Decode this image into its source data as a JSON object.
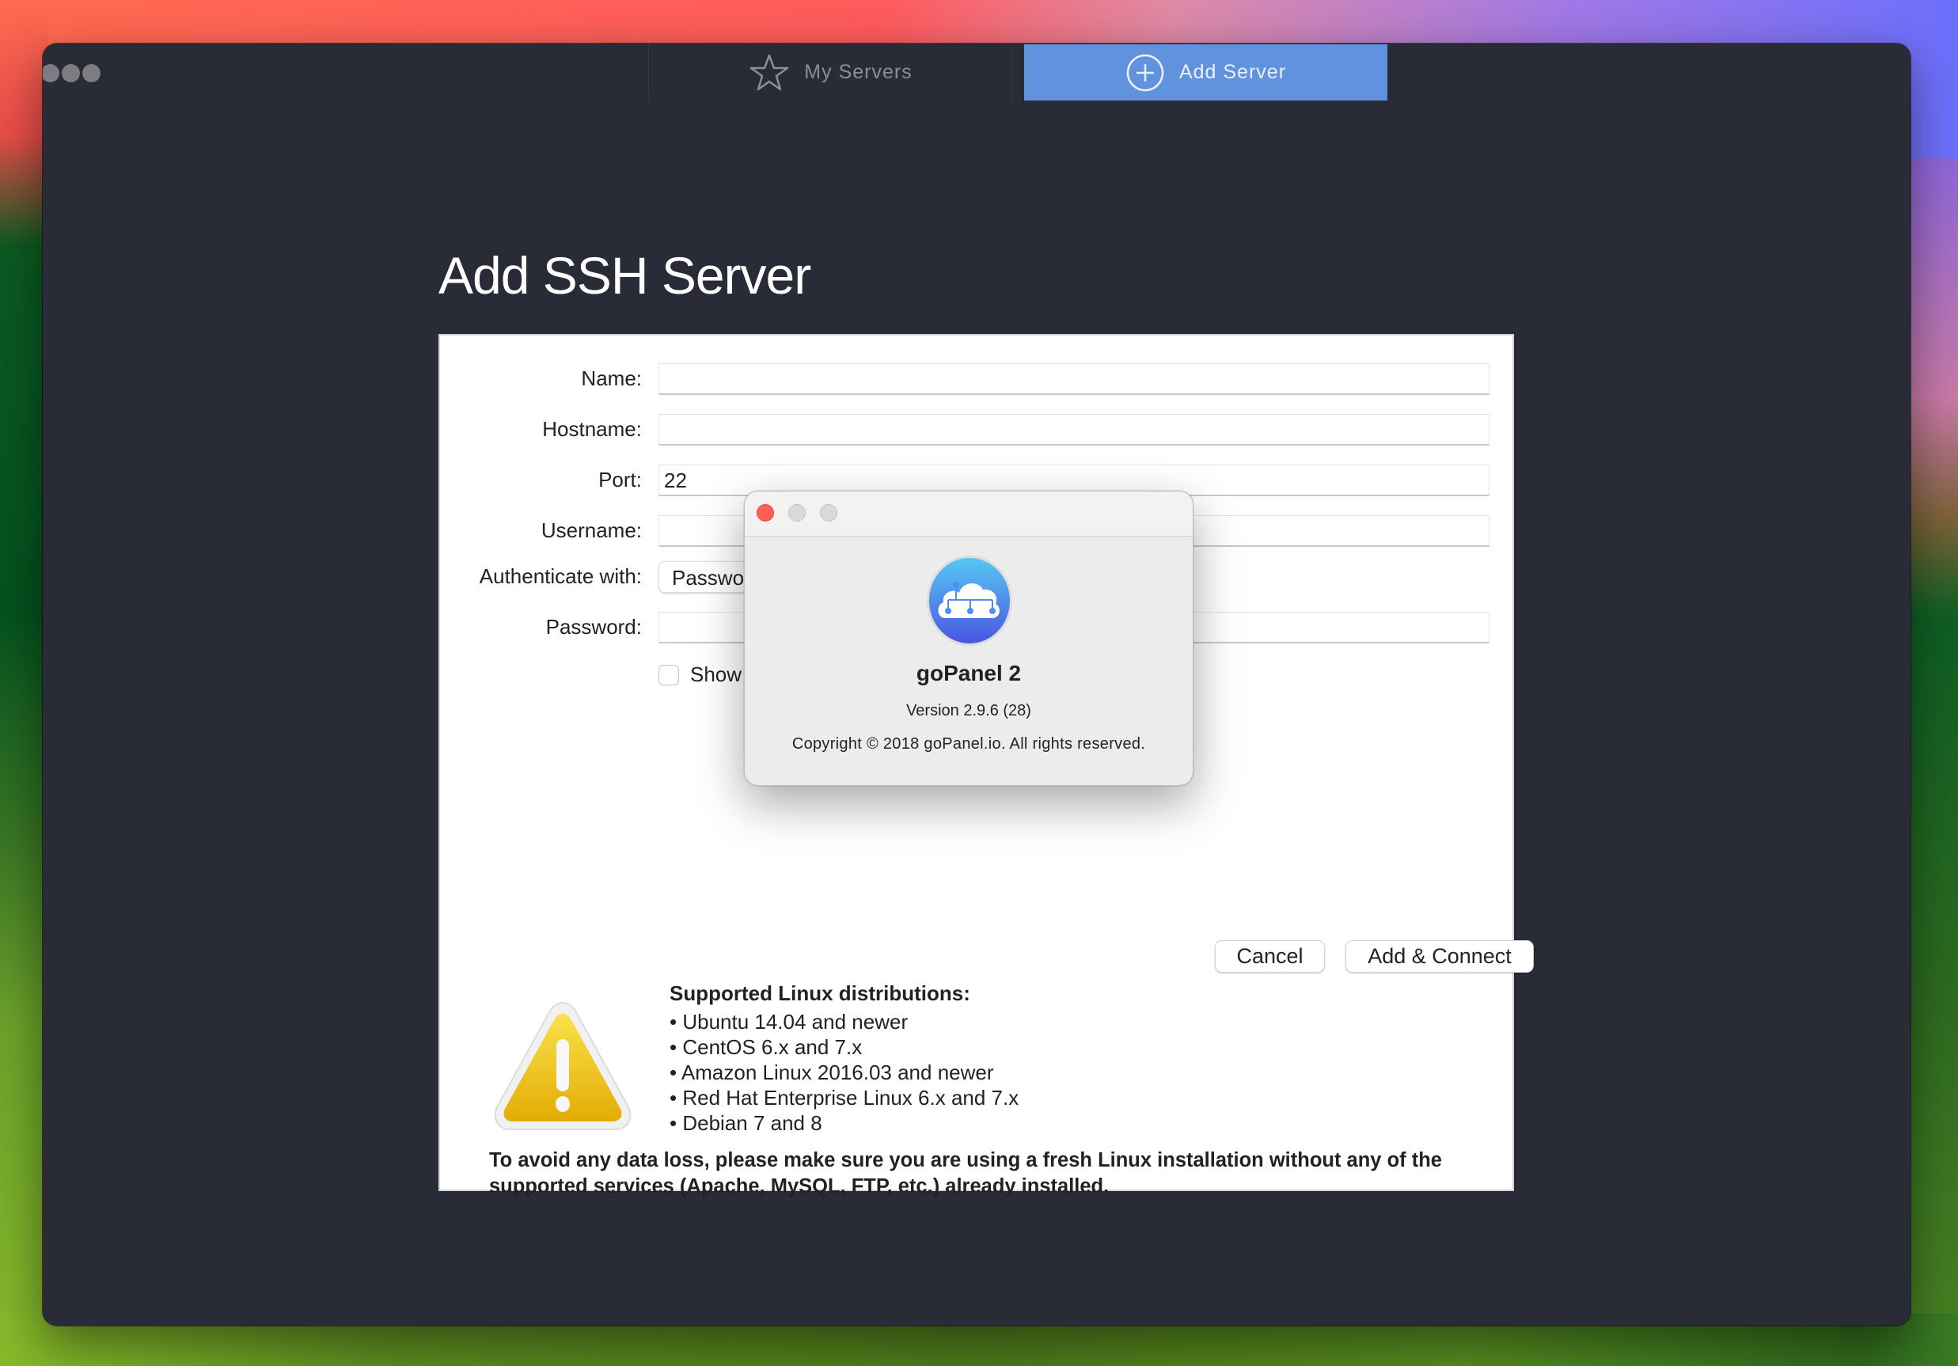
{
  "window": {
    "tabs": [
      {
        "label": "My Servers",
        "icon": "star-icon",
        "active": false
      },
      {
        "label": "Add Server",
        "icon": "plus-circle-icon",
        "active": true
      }
    ],
    "accent_color": "#6092de",
    "background_color": "#292c36"
  },
  "main": {
    "title": "Add SSH Server",
    "form": {
      "name": {
        "label": "Name:",
        "value": ""
      },
      "hostname": {
        "label": "Hostname:",
        "value": ""
      },
      "port": {
        "label": "Port:",
        "value": "22"
      },
      "username": {
        "label": "Username:",
        "value": ""
      },
      "auth": {
        "label": "Authenticate with:",
        "selected": "Password"
      },
      "password": {
        "label": "Password:",
        "value": ""
      },
      "show_password": {
        "label": "Show password",
        "checked": false
      }
    },
    "buttons": {
      "cancel": "Cancel",
      "add_connect": "Add & Connect"
    },
    "supported": {
      "title": "Supported Linux distributions:",
      "items": [
        "Ubuntu 14.04 and newer",
        "CentOS 6.x and 7.x",
        "Amazon Linux 2016.03 and newer",
        "Red Hat Enterprise Linux 6.x and 7.x",
        "Debian 7 and 8"
      ]
    },
    "warning": "To avoid any data loss, please make sure you are using a fresh Linux installation without any of the supported services (Apache, MySQL, FTP, etc.) already installed."
  },
  "about_dialog": {
    "app_name": "goPanel 2",
    "version": "Version 2.9.6 (28)",
    "copyright": "Copyright © 2018 goPanel.io. All rights reserved."
  }
}
